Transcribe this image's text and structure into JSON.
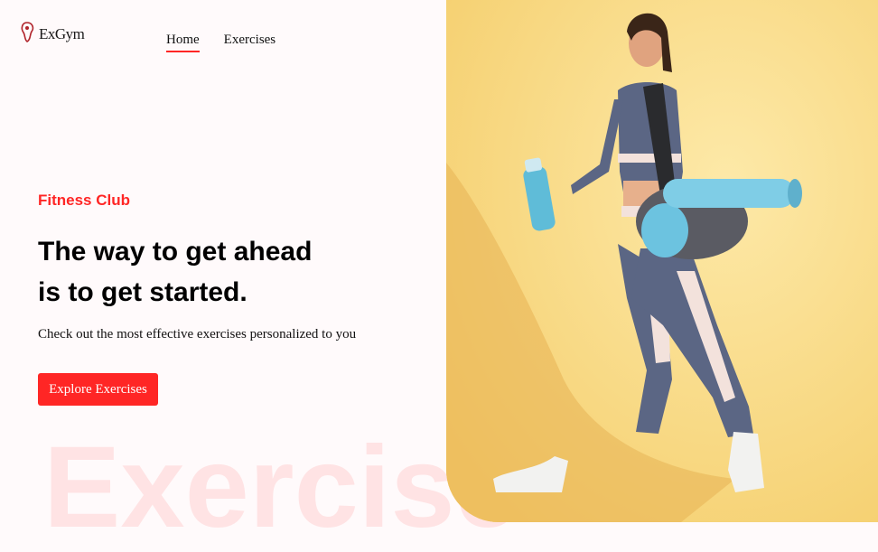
{
  "header": {
    "brand": "ExGym",
    "logo_icon": "dumbbell-logo-icon",
    "nav": [
      {
        "label": "Home",
        "active": true
      },
      {
        "label": "Exercises",
        "active": false
      }
    ]
  },
  "hero": {
    "kicker": "Fitness Club",
    "title_line1": "The way to get ahead",
    "title_line2": "is to get started.",
    "subtitle": "Check out the most effective exercises personalized to you",
    "cta_label": "Explore Exercises",
    "background_word": "Exercise"
  },
  "colors": {
    "accent": "#ff2625",
    "page_bg": "#fffafb",
    "banner_bg": "#f7d785"
  }
}
